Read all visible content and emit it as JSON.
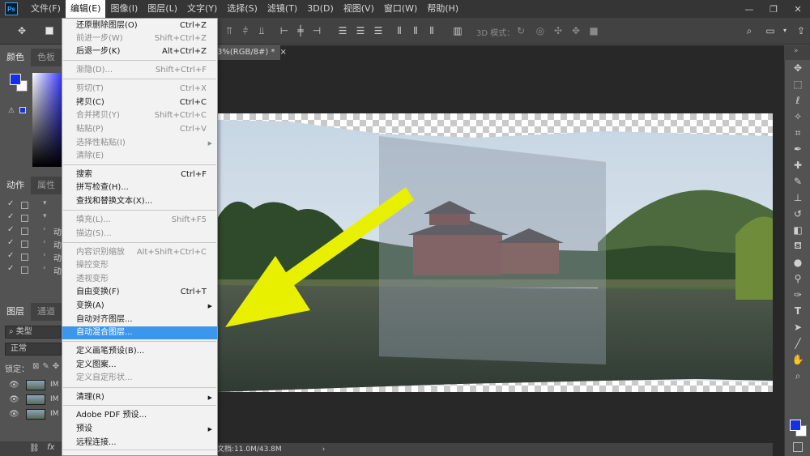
{
  "app": {
    "logo": "Ps"
  },
  "menubar": {
    "items": [
      {
        "label": "文件(F)",
        "active": false
      },
      {
        "label": "编辑(E)",
        "active": true
      },
      {
        "label": "图像(I)",
        "active": false
      },
      {
        "label": "图层(L)",
        "active": false
      },
      {
        "label": "文字(Y)",
        "active": false
      },
      {
        "label": "选择(S)",
        "active": false
      },
      {
        "label": "滤镜(T)",
        "active": false
      },
      {
        "label": "3D(D)",
        "active": false
      },
      {
        "label": "视图(V)",
        "active": false
      },
      {
        "label": "窗口(W)",
        "active": false
      },
      {
        "label": "帮助(H)",
        "active": false
      }
    ],
    "minimize": "—",
    "restore": "❐",
    "close": "✕"
  },
  "options": {
    "mode_3d_label": "3D 模式："
  },
  "color_panel": {
    "tabs": [
      "颜色",
      "色板"
    ],
    "fg": "#1530e8",
    "bg": "#ffffff"
  },
  "actions_panel": {
    "tabs": [
      "动作",
      "属性"
    ],
    "rows": [
      {
        "check": "✓",
        "arrow": "▾",
        "name": ""
      },
      {
        "check": "✓",
        "arrow": "▾",
        "name": ""
      },
      {
        "check": "✓",
        "arrow": "›",
        "name": "动"
      },
      {
        "check": "✓",
        "arrow": "›",
        "name": "动"
      },
      {
        "check": "✓",
        "arrow": "›",
        "name": "动"
      },
      {
        "check": "✓",
        "arrow": "›",
        "name": "动"
      }
    ]
  },
  "layers_panel": {
    "tabs": [
      "图层",
      "通道"
    ],
    "filter": "类型",
    "blend": "正常",
    "lock_label": "锁定：",
    "layers": [
      "IM",
      "IM",
      "IM"
    ],
    "fx": "fx"
  },
  "document": {
    "tab_label": "3%(RGB/8#) *",
    "status": "文档:11.0M/43.8M"
  },
  "edit_menu": {
    "items": [
      {
        "label": "还原删除图层(O)",
        "shortcut": "Ctrl+Z",
        "state": "normal"
      },
      {
        "label": "前进一步(W)",
        "shortcut": "Shift+Ctrl+Z",
        "state": "disabled"
      },
      {
        "label": "后退一步(K)",
        "shortcut": "Alt+Ctrl+Z",
        "state": "normal"
      },
      {
        "label": "渐隐(D)...",
        "shortcut": "Shift+Ctrl+F",
        "state": "disabled"
      },
      {
        "label": "剪切(T)",
        "shortcut": "Ctrl+X",
        "state": "disabled"
      },
      {
        "label": "拷贝(C)",
        "shortcut": "Ctrl+C",
        "state": "normal"
      },
      {
        "label": "合并拷贝(Y)",
        "shortcut": "Shift+Ctrl+C",
        "state": "disabled"
      },
      {
        "label": "粘贴(P)",
        "shortcut": "Ctrl+V",
        "state": "disabled"
      },
      {
        "label": "选择性粘贴(I)",
        "shortcut": "",
        "state": "disabled",
        "submenu": true
      },
      {
        "label": "清除(E)",
        "shortcut": "",
        "state": "disabled"
      },
      {
        "label": "搜索",
        "shortcut": "Ctrl+F",
        "state": "normal"
      },
      {
        "label": "拼写检查(H)...",
        "shortcut": "",
        "state": "normal"
      },
      {
        "label": "查找和替换文本(X)...",
        "shortcut": "",
        "state": "normal"
      },
      {
        "label": "填充(L)...",
        "shortcut": "Shift+F5",
        "state": "disabled"
      },
      {
        "label": "描边(S)...",
        "shortcut": "",
        "state": "disabled"
      },
      {
        "label": "内容识别缩放",
        "shortcut": "Alt+Shift+Ctrl+C",
        "state": "disabled"
      },
      {
        "label": "操控变形",
        "shortcut": "",
        "state": "disabled"
      },
      {
        "label": "透视变形",
        "shortcut": "",
        "state": "disabled"
      },
      {
        "label": "自由变换(F)",
        "shortcut": "Ctrl+T",
        "state": "normal"
      },
      {
        "label": "变换(A)",
        "shortcut": "",
        "state": "normal",
        "submenu": true
      },
      {
        "label": "自动对齐图层...",
        "shortcut": "",
        "state": "normal"
      },
      {
        "label": "自动混合图层...",
        "shortcut": "",
        "state": "highlighted"
      },
      {
        "label": "定义画笔预设(B)...",
        "shortcut": "",
        "state": "normal"
      },
      {
        "label": "定义图案...",
        "shortcut": "",
        "state": "normal"
      },
      {
        "label": "定义自定形状...",
        "shortcut": "",
        "state": "disabled"
      },
      {
        "label": "清理(R)",
        "shortcut": "",
        "state": "normal",
        "submenu": true
      },
      {
        "label": "Adobe PDF 预设...",
        "shortcut": "",
        "state": "normal"
      },
      {
        "label": "预设",
        "shortcut": "",
        "state": "normal",
        "submenu": true
      },
      {
        "label": "远程连接...",
        "shortcut": "",
        "state": "normal"
      }
    ]
  },
  "right_tools": [
    "move-icon",
    "marquee-icon",
    "lasso-icon",
    "magic-wand-icon",
    "crop-icon",
    "eyedropper-icon",
    "healing-icon",
    "brush-icon",
    "stamp-icon",
    "history-brush-icon",
    "eraser-icon",
    "paint-bucket-icon",
    "blur-icon",
    "dodge-icon",
    "pen-icon",
    "type-icon",
    "path-select-icon",
    "line-icon",
    "hand-icon",
    "zoom-icon"
  ]
}
